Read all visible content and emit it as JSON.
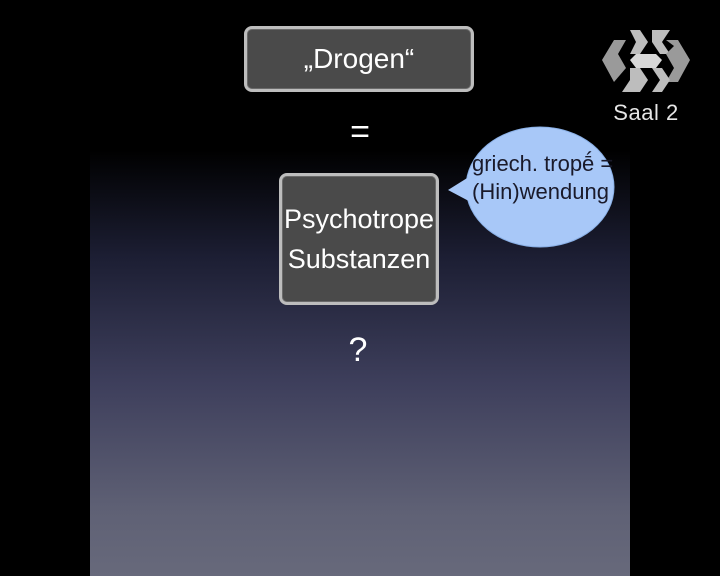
{
  "slide": {
    "title_box": "„Drogen“",
    "equals": "=",
    "term_line1": "Psychotrope",
    "term_line2": "Substanzen",
    "question": "?",
    "bubble_line1": "griech. tropḗ  =",
    "bubble_line2": "(Hin)wendung"
  },
  "overlay": {
    "logo_icon": "ccc-logo-icon",
    "room_label": "Saal 2"
  },
  "colors": {
    "background": "#000000",
    "box_fill": "#4a4a4a",
    "box_border": "#bdbdbd",
    "bubble_fill": "#a8c8f8",
    "text": "#ffffff"
  }
}
